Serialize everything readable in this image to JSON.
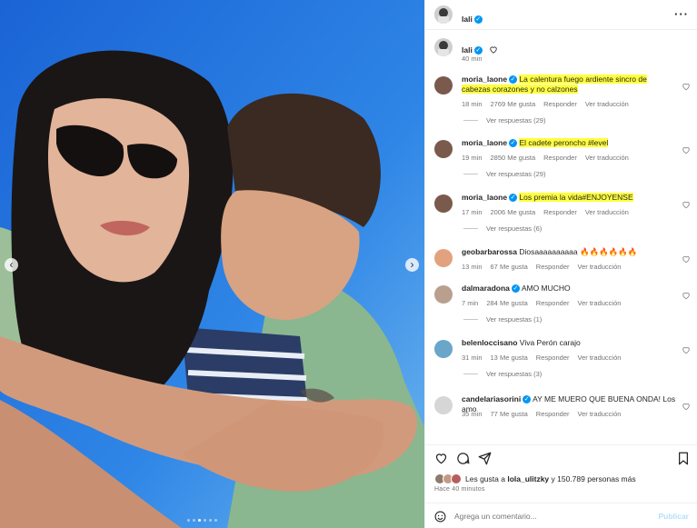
{
  "post": {
    "author": "lali",
    "caption_time": "40 min",
    "carousel": {
      "slides": 6,
      "current_slide": 3
    }
  },
  "comments": [
    {
      "user": "moria_laone",
      "verified": true,
      "text": "La calentura fuego ardiente sincro de cabezas corazones y no calzones",
      "highlight": true,
      "time": "18 min",
      "likes": "2769 Me gusta",
      "reply": "Responder",
      "translate": "Ver traducción",
      "replies": "Ver respuestas (29)"
    },
    {
      "user": "moria_laone",
      "verified": true,
      "text": "El cadete peroncho #level",
      "highlight": true,
      "time": "19 min",
      "likes": "2850 Me gusta",
      "reply": "Responder",
      "translate": "Ver traducción",
      "replies": "Ver respuestas (29)"
    },
    {
      "user": "moria_laone",
      "verified": true,
      "text": "Los premia la vida#ENJOYENSE",
      "highlight": true,
      "time": "17 min",
      "likes": "2006 Me gusta",
      "reply": "Responder",
      "translate": "Ver traducción",
      "replies": "Ver respuestas (6)"
    },
    {
      "user": "geobarbarossa",
      "verified": false,
      "text": "Diosaaaaaaaaaa 🔥🔥🔥🔥🔥🔥",
      "highlight": false,
      "time": "13 min",
      "likes": "67 Me gusta",
      "reply": "Responder",
      "translate": "Ver traducción",
      "replies": ""
    },
    {
      "user": "dalmaradona",
      "verified": true,
      "text": "AMO MUCHO",
      "highlight": false,
      "time": "7 min",
      "likes": "284 Me gusta",
      "reply": "Responder",
      "translate": "Ver traducción",
      "replies": "Ver respuestas (1)"
    },
    {
      "user": "belenloccisano",
      "verified": false,
      "text": "Viva Perón carajo",
      "highlight": false,
      "time": "31 min",
      "likes": "13 Me gusta",
      "reply": "Responder",
      "translate": "Ver traducción",
      "replies": "Ver respuestas (3)"
    },
    {
      "user": "candelariasorini",
      "verified": true,
      "text": "AY ME MUERO QUE BUENA ONDA! Los amo",
      "highlight": false,
      "time": "35 min",
      "likes": "77 Me gusta",
      "reply": "Responder",
      "translate": "Ver traducción",
      "replies": ""
    }
  ],
  "footer": {
    "likes_prefix": "Les gusta a",
    "likes_user": "lola_ulitzky",
    "likes_suffix": "y 150.789 personas más",
    "timestamp": "Hace 40 minutos",
    "comment_placeholder": "Agrega un comentario...",
    "publish_label": "Publicar"
  },
  "colors": {
    "highlight": "#ffff3d",
    "verified": "#0095f6",
    "publish": "#b2dffc"
  }
}
